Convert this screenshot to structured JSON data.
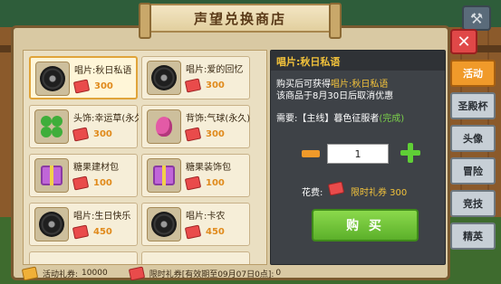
{
  "header": {
    "title": "声望兑换商店"
  },
  "shop_items": [
    {
      "name": "唱片:秋日私语",
      "price": "300",
      "icon": "vinyl-record-icon",
      "selected": true
    },
    {
      "name": "唱片:爱的回忆",
      "price": "300",
      "icon": "vinyl-record-icon"
    },
    {
      "name": "头饰:幸运草(永久",
      "price": "300",
      "icon": "clover-icon"
    },
    {
      "name": "背饰:气球(永久)",
      "price": "300",
      "icon": "balloon-icon"
    },
    {
      "name": "糖果建材包",
      "price": "100",
      "icon": "candy-pack-icon"
    },
    {
      "name": "糖果装饰包",
      "price": "100",
      "icon": "candy-pack-icon"
    },
    {
      "name": "唱片:生日快乐",
      "price": "450",
      "icon": "vinyl-record-icon"
    },
    {
      "name": "唱片:卡农",
      "price": "450",
      "icon": "vinyl-record-icon"
    }
  ],
  "detail": {
    "title": "唱片:秋日私语",
    "line1_prefix": "购买后可获得",
    "line1_item": "唱片:秋日私语",
    "line2": "该商品于8月30日后取消优惠",
    "req_prefix": "需要:【主线】暮色征服者",
    "req_status": "(完成)",
    "quantity": "1",
    "cost_label": "花费:",
    "cost_value": "限时礼券 300",
    "buy_label": "购 买"
  },
  "footer": {
    "activity_ticket_label": "活动礼券:",
    "activity_ticket_value": "10000",
    "limited_ticket_text": "限时礼券[有效期至09月07日0点]:",
    "limited_ticket_value": "0"
  },
  "side_tabs": [
    {
      "label": "活动",
      "active": true
    },
    {
      "label": "圣殿杯"
    },
    {
      "label": "头像"
    },
    {
      "label": "冒险"
    },
    {
      "label": "竞技"
    },
    {
      "label": "精英"
    }
  ],
  "colors": {
    "accent": "#f09a2a",
    "highlight": "#f2c23b",
    "buy": "#5cb02a",
    "close": "#e04848"
  }
}
